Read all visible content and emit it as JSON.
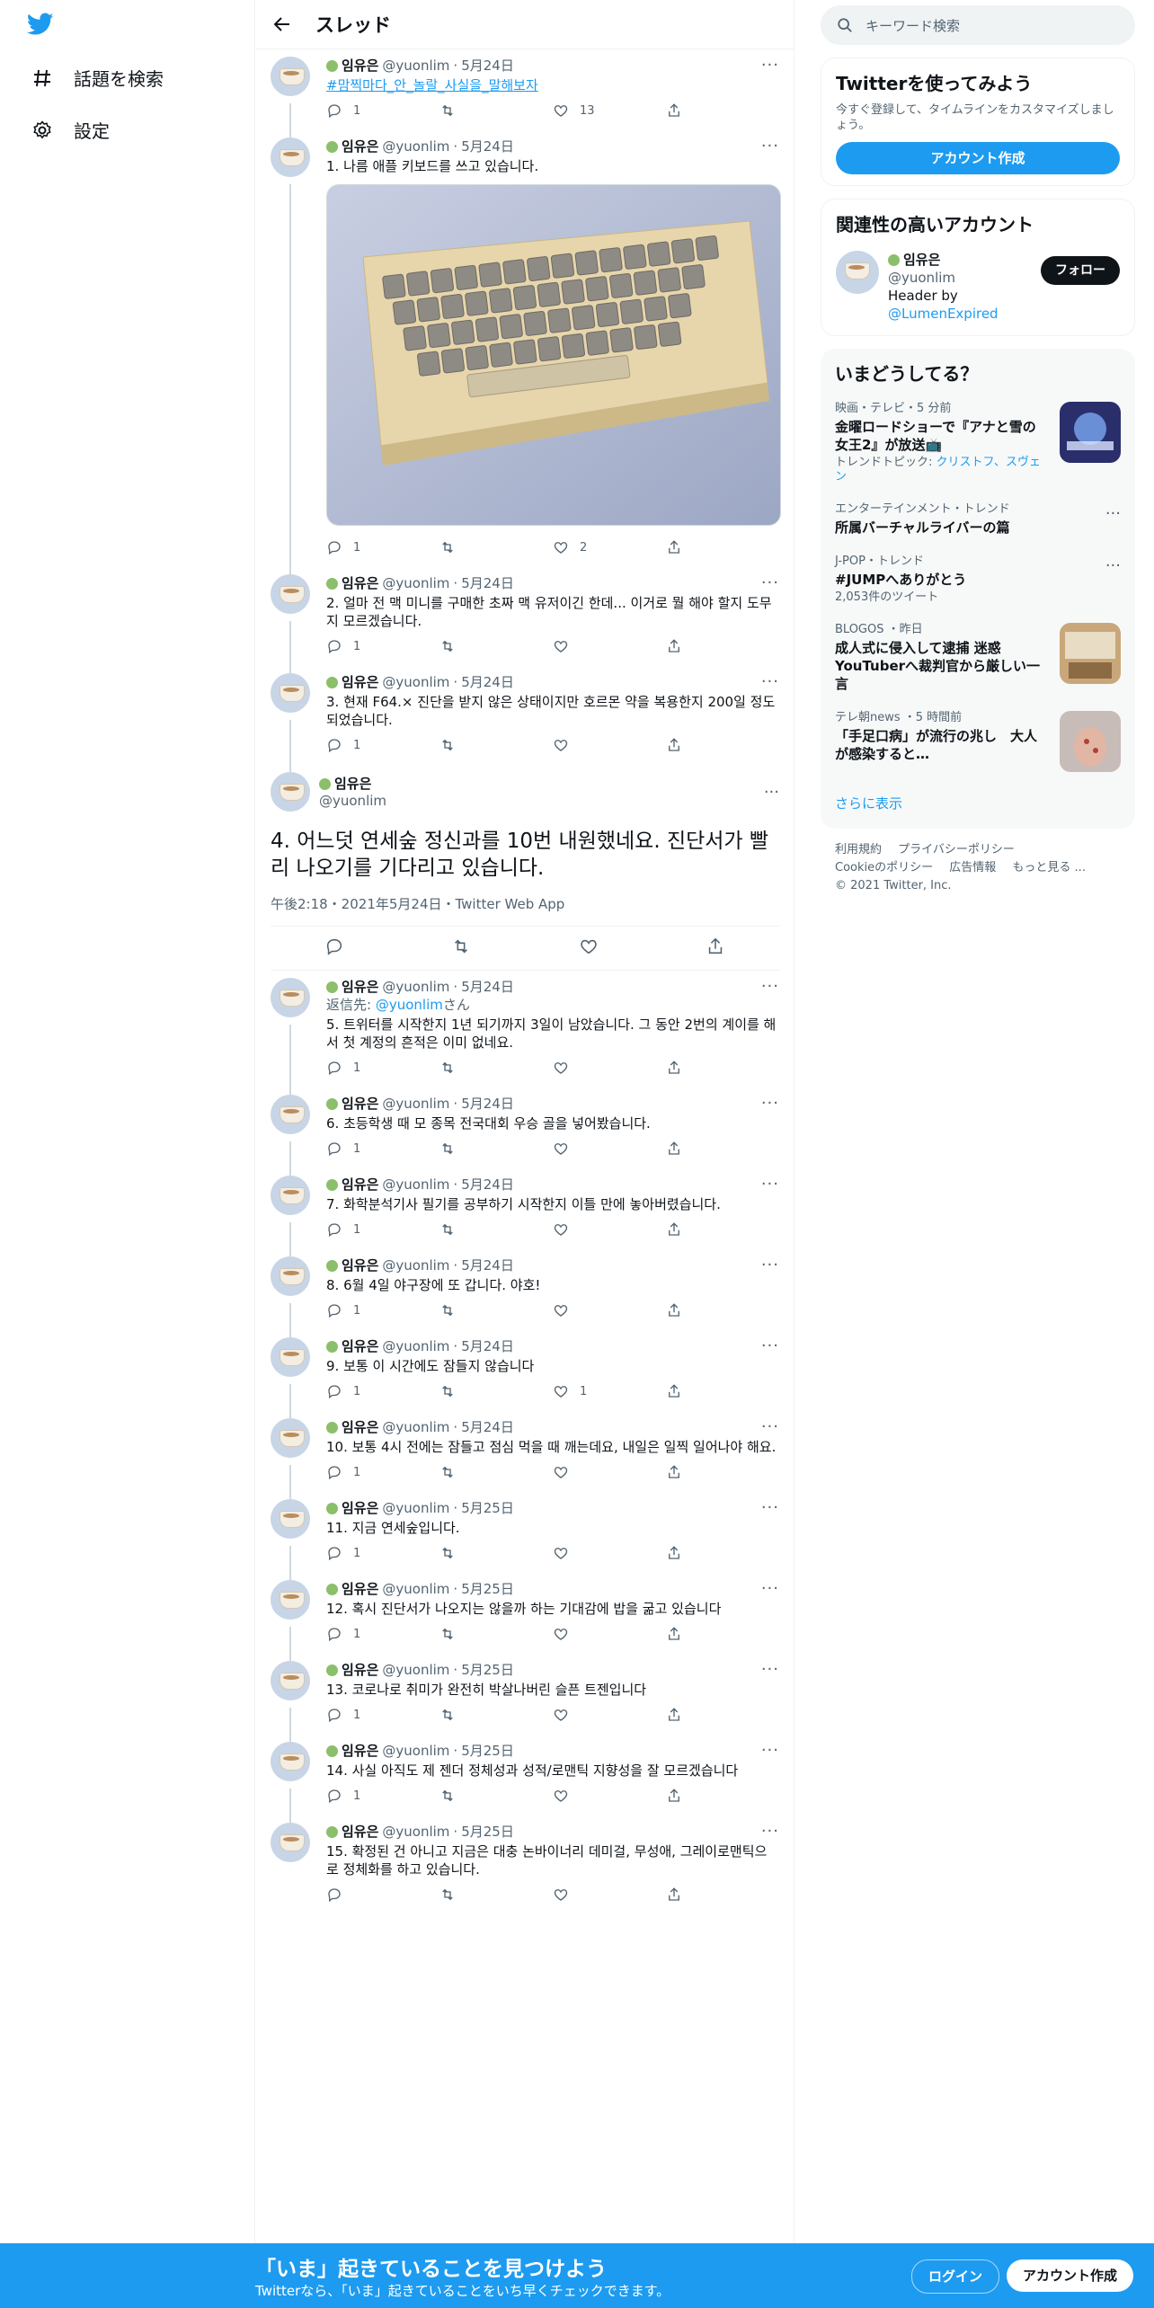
{
  "nav": {
    "explore_label": "話題を検索",
    "settings_label": "設定"
  },
  "header": {
    "title": "スレッド"
  },
  "tweets_before": [
    {
      "name": "임유은",
      "handle": "@yuonlim",
      "dot": "·",
      "date": "5月24日",
      "text": "#맘찍마다_안_놀랄_사실을_말해보자",
      "hashtag": true,
      "replies": "1",
      "retweets": "",
      "likes": "13"
    },
    {
      "name": "임유은",
      "handle": "@yuonlim",
      "dot": "·",
      "date": "5月24日",
      "text": "1. 나름 애플 키보드를 쓰고 있습니다.",
      "image": "keyboard-photo",
      "replies": "1",
      "retweets": "",
      "likes": "2"
    },
    {
      "name": "임유은",
      "handle": "@yuonlim",
      "dot": "·",
      "date": "5月24日",
      "text": "2. 얼마 전 맥 미니를 구매한 초짜 맥 유저이긴 한데... 이거로 뭘 해야 할지 도무지 모르겠습니다.",
      "replies": "1",
      "retweets": "",
      "likes": ""
    },
    {
      "name": "임유은",
      "handle": "@yuonlim",
      "dot": "·",
      "date": "5月24日",
      "text": "3. 현재 F64.× 진단을 받지 않은 상태이지만 호르몬 약을 복용한지 200일 정도 되었습니다.",
      "replies": "1",
      "retweets": "",
      "likes": ""
    }
  ],
  "focus": {
    "name": "임유은",
    "handle": "@yuonlim",
    "text": "4. 어느덧 연세숲 정신과를 10번 내원했네요. 진단서가 빨리 나오기를 기다리고 있습니다.",
    "timestamp": "午後2:18・2021年5月24日・Twitter Web App"
  },
  "reply_to_label": "返信先:",
  "reply_to_handle": "@yuonlim",
  "reply_to_suffix": "さん",
  "tweets_after": [
    {
      "name": "임유은",
      "handle": "@yuonlim",
      "dot": "·",
      "date": "5月24日",
      "reply": true,
      "text": "5. 트위터를 시작한지 1년 되기까지 3일이 남았습니다. 그 동안 2번의 계이를 해서 첫 계정의 흔적은 이미 없네요.",
      "replies": "1",
      "retweets": "",
      "likes": ""
    },
    {
      "name": "임유은",
      "handle": "@yuonlim",
      "dot": "·",
      "date": "5月24日",
      "text": "6. 초등학생 때 모 종목 전국대회 우승 골을 넣어봤습니다.",
      "replies": "1",
      "retweets": "",
      "likes": ""
    },
    {
      "name": "임유은",
      "handle": "@yuonlim",
      "dot": "·",
      "date": "5月24日",
      "text": "7. 화학분석기사 필기를 공부하기 시작한지 이틀 만에 놓아버렸습니다.",
      "replies": "1",
      "retweets": "",
      "likes": ""
    },
    {
      "name": "임유은",
      "handle": "@yuonlim",
      "dot": "·",
      "date": "5月24日",
      "text": "8. 6월 4일 야구장에 또 갑니다. 야호!",
      "replies": "1",
      "retweets": "",
      "likes": ""
    },
    {
      "name": "임유은",
      "handle": "@yuonlim",
      "dot": "·",
      "date": "5月24日",
      "text": "9. 보통 이 시간에도 잠들지 않습니다",
      "replies": "1",
      "retweets": "",
      "likes": "1"
    },
    {
      "name": "임유은",
      "handle": "@yuonlim",
      "dot": "·",
      "date": "5月24日",
      "text": "10. 보통 4시 전에는 잠들고 점심 먹을 때 깨는데요, 내일은 일찍 일어나야 해요.",
      "replies": "1",
      "retweets": "",
      "likes": ""
    },
    {
      "name": "임유은",
      "handle": "@yuonlim",
      "dot": "·",
      "date": "5月25日",
      "text": "11. 지금 연세숲입니다.",
      "replies": "1",
      "retweets": "",
      "likes": ""
    },
    {
      "name": "임유은",
      "handle": "@yuonlim",
      "dot": "·",
      "date": "5月25日",
      "text": "12. 혹시 진단서가 나오지는 않을까 하는 기대감에 밥을 굶고 있습니다",
      "replies": "1",
      "retweets": "",
      "likes": ""
    },
    {
      "name": "임유은",
      "handle": "@yuonlim",
      "dot": "·",
      "date": "5月25日",
      "text": "13. 코로나로 취미가 완전히 박살나버린 슬픈 트젠입니다",
      "replies": "1",
      "retweets": "",
      "likes": ""
    },
    {
      "name": "임유은",
      "handle": "@yuonlim",
      "dot": "·",
      "date": "5月25日",
      "text": "14. 사실 아직도 제 젠더 정체성과 성적/로맨틱 지향성을 잘 모르겠습니다",
      "replies": "1",
      "retweets": "",
      "likes": ""
    },
    {
      "name": "임유은",
      "handle": "@yuonlim",
      "dot": "·",
      "date": "5月25日",
      "text": "15. 확정된 건 아니고 지금은 대충 논바이너리 데미걸, 무성애, 그레이로맨틱으로 정체화를 하고 있습니다.",
      "replies": "",
      "retweets": "",
      "likes": "",
      "last": true
    }
  ],
  "sidebar": {
    "search_placeholder": "キーワード検索",
    "join": {
      "title": "Twitterを使ってみよう",
      "sub": "今すぐ登録して、タイムラインをカスタマイズしましょう。",
      "button": "アカウント作成"
    },
    "related": {
      "title": "関連性の高いアカウント",
      "name": "임유은",
      "handle": "@yuonlim",
      "bio_prefix": "Header by",
      "bio_link": "@LumenExpired",
      "follow": "フォロー"
    },
    "trends": {
      "title": "いまどうしてる？",
      "items": [
        {
          "ctx": "映画・テレビ・5 分前",
          "title": "金曜ロードショーで『アナと雪の女王2』が放送📺",
          "sub_prefix": "トレンドトピック: ",
          "sub_link": "クリストフ、スヴェン",
          "thumb": "frozen"
        },
        {
          "ctx": "エンターテインメント・トレンド",
          "title": "所属バーチャルライバーの篇",
          "more": true
        },
        {
          "ctx": "J-POP・トレンド",
          "title": "#JUMPへありがとう",
          "sub_prefix": "2,053件のツイート",
          "more": true
        },
        {
          "ctx": "BLOGOS ・昨日",
          "title": "成人式に侵入して逮捕 迷惑YouTuberへ裁判官から厳しい一言",
          "thumb": "court"
        },
        {
          "ctx": "テレ朝news ・5 時間前",
          "title": "「手足口病」が流行の兆し　大人が感染すると…",
          "thumb": "hand"
        }
      ],
      "show_more": "さらに表示"
    },
    "footer": {
      "links": [
        "利用規約",
        "プライバシーポリシー",
        "Cookieのポリシー",
        "広告情報",
        "もっと見る ..."
      ],
      "copyright": "© 2021 Twitter, Inc."
    }
  },
  "bottom": {
    "title": "「いま」起きていることを見つけよう",
    "sub": "Twitterなら、「いま」起きていることをいち早くチェックできます。",
    "login": "ログイン",
    "signup": "アカウント作成"
  },
  "colors": {
    "accent": "#1d9bf0",
    "text": "#0f1419",
    "muted": "#536471"
  }
}
